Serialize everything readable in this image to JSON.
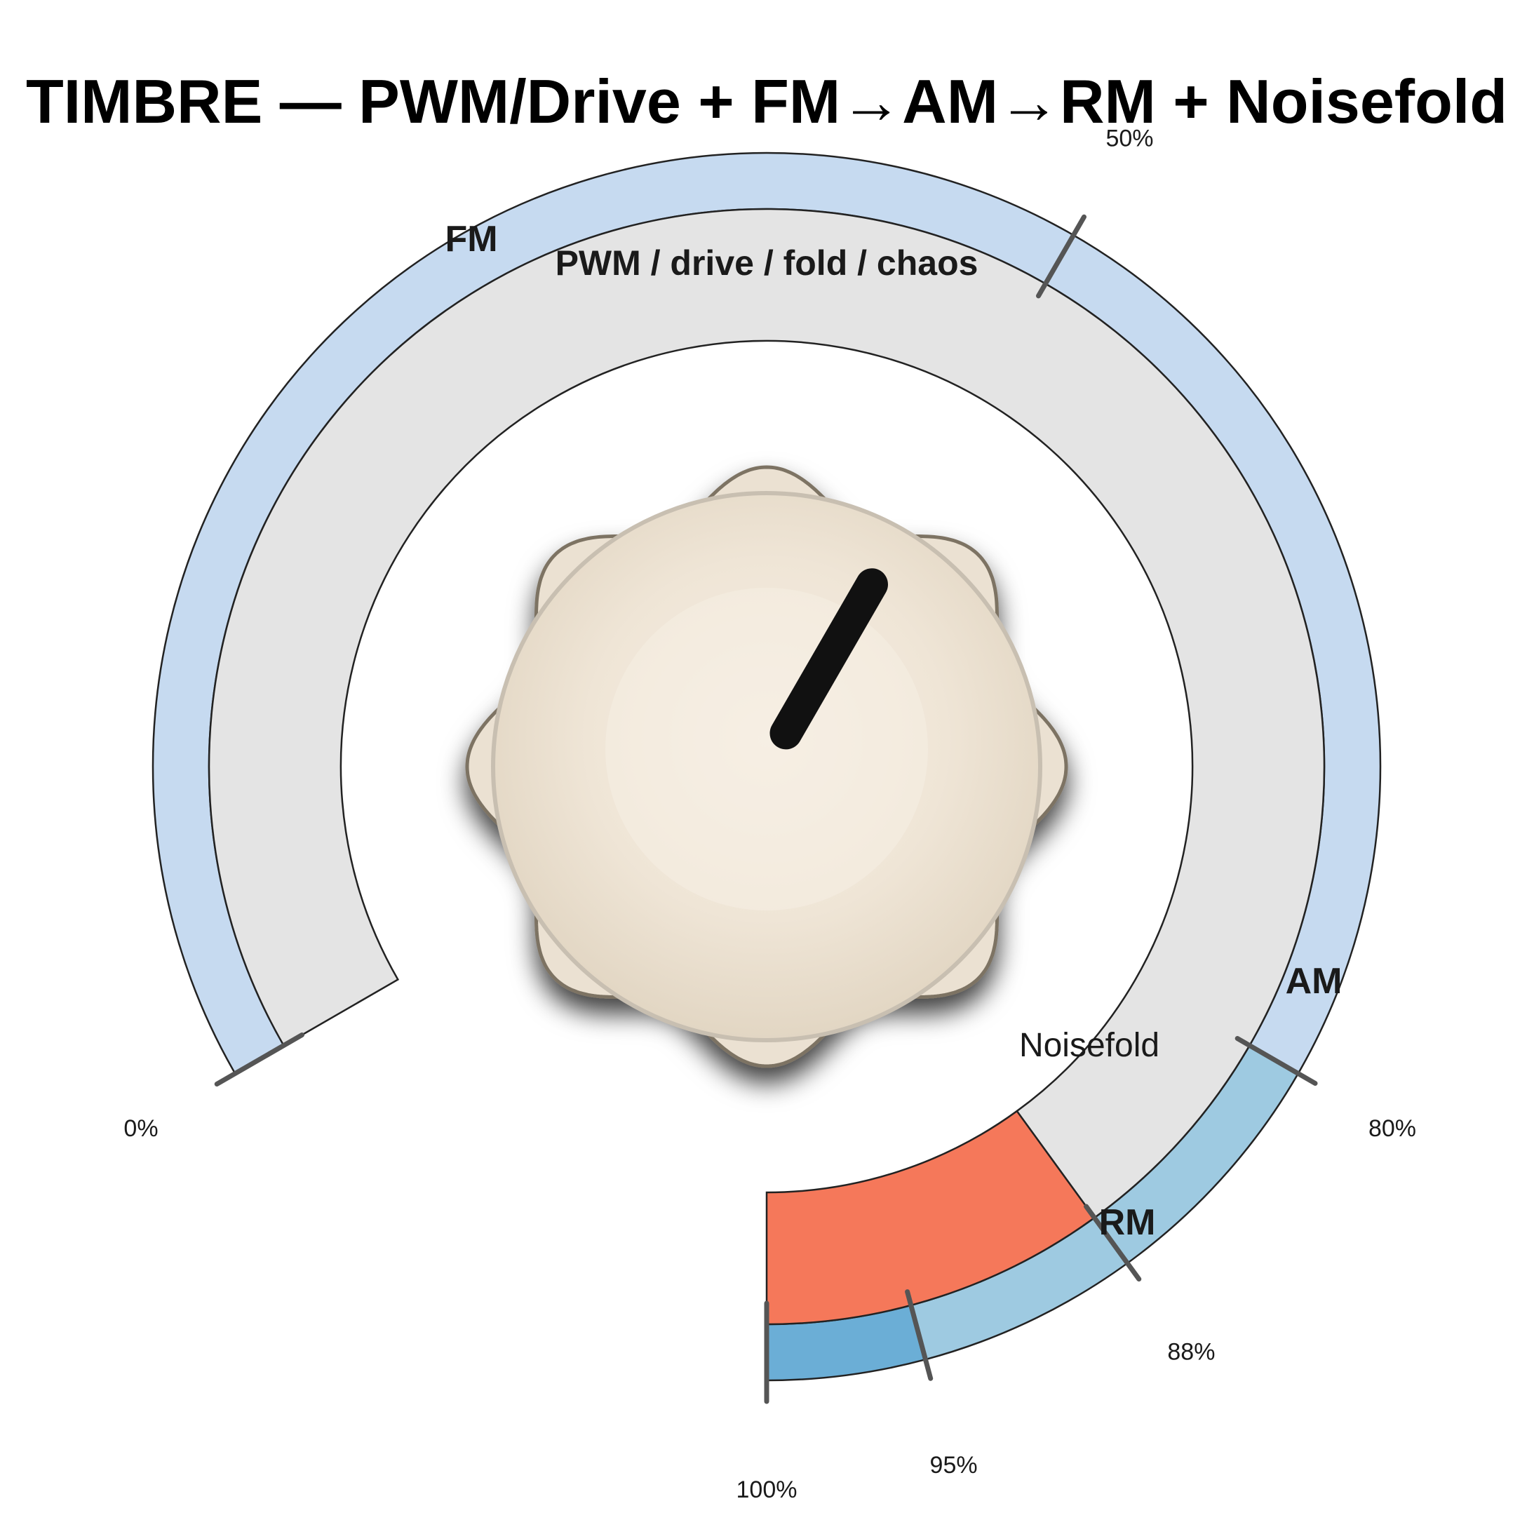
{
  "title": "TIMBRE — PWM/Drive + FM→AM→RM + Noisefold",
  "colors": {
    "outer_base": "#c6daf0",
    "outer_am": "#9ecae1",
    "outer_rm": "#6baed6",
    "inner_band": "#e4e4e4",
    "noisefold": "#f5785a",
    "tick": "#555555",
    "edge": "#222222",
    "knob": "#efe6d8",
    "pointer": "#111111"
  },
  "dial": {
    "value_pct": 50,
    "inner_band_label": "PWM / drive / fold / chaos",
    "segments": [
      {
        "id": "fm",
        "label": "FM",
        "start_pct": 0,
        "end_pct": 80
      },
      {
        "id": "am",
        "label": "AM",
        "start_pct": 80,
        "end_pct": 95
      },
      {
        "id": "rm",
        "label": "RM",
        "start_pct": 95,
        "end_pct": 100
      }
    ],
    "noisefold": {
      "label": "Noisefold",
      "start_pct": 88,
      "end_pct": 100
    },
    "ticks": [
      {
        "pct": 0,
        "label": "0%"
      },
      {
        "pct": 50,
        "label": "50%"
      },
      {
        "pct": 80,
        "label": "80%"
      },
      {
        "pct": 88,
        "label": "88%"
      },
      {
        "pct": 95,
        "label": "95%"
      },
      {
        "pct": 100,
        "label": "100%"
      }
    ]
  }
}
